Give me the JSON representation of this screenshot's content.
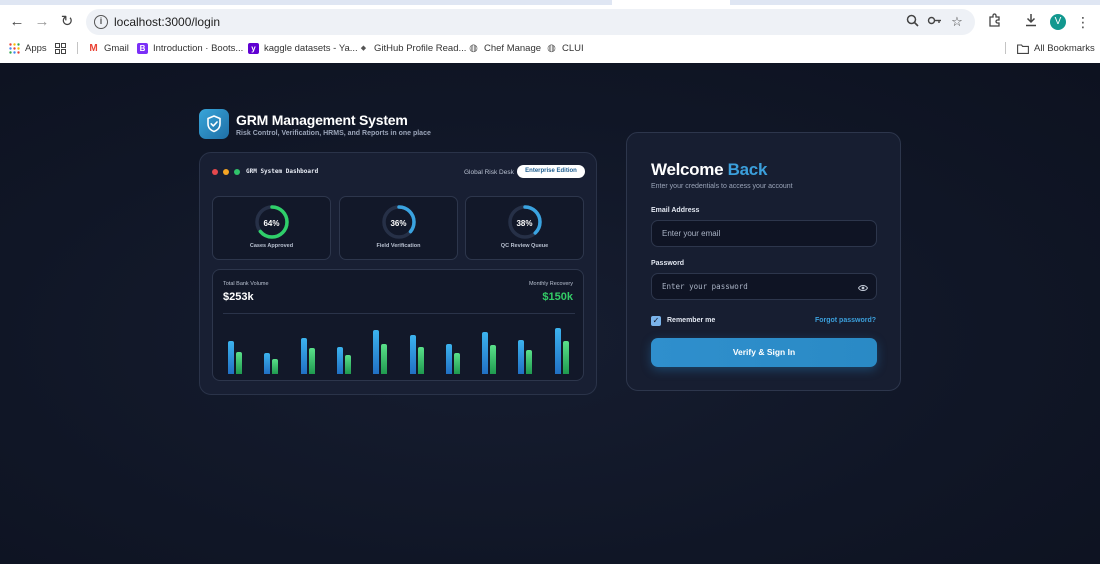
{
  "browser": {
    "url": "localhost:3000/login",
    "avatar_letter": "V",
    "bookmarks": [
      {
        "label": "Apps",
        "icon": "apps-grid-icon"
      },
      {
        "label": "",
        "icon": "tab-groups-icon"
      },
      {
        "label": "Gmail",
        "icon": "gmail-icon"
      },
      {
        "label": "Introduction · Boots...",
        "icon": "bootstrap-icon"
      },
      {
        "label": "kaggle datasets - Ya...",
        "icon": "yahoo-icon"
      },
      {
        "label": "GitHub Profile Read...",
        "icon": "github-icon"
      },
      {
        "label": "Chef Manage",
        "icon": "globe-icon"
      },
      {
        "label": "CLUI",
        "icon": "globe-icon"
      }
    ],
    "all_bookmarks": "All Bookmarks"
  },
  "brand": {
    "title": "GRM Management System",
    "subtitle": "Risk Control, Verification, HRMS, and Reports in one place",
    "logo_icon": "shield-check-icon"
  },
  "dashboard": {
    "title": "GRM System Dashboard",
    "desk": "Global Risk Desk",
    "edition": "Enterprise Edition",
    "window_dots": [
      "#e5484d",
      "#f5a524",
      "#30c36b"
    ],
    "kpis": [
      {
        "percent": "64%",
        "value": 64,
        "label": "Cases Approved",
        "color": "#2fcf6a"
      },
      {
        "percent": "36%",
        "value": 36,
        "label": "Field Verification",
        "color": "#3aa3e0"
      },
      {
        "percent": "38%",
        "value": 38,
        "label": "QC Review Queue",
        "color": "#3aa3e0"
      }
    ],
    "volume_label": "Total Bank Volume",
    "volume_value": "$253k",
    "recovery_label": "Monthly Recovery",
    "recovery_value": "$150k",
    "bars": [
      {
        "blue": 0.66,
        "green": 0.45
      },
      {
        "blue": 0.42,
        "green": 0.3
      },
      {
        "blue": 0.72,
        "green": 0.52
      },
      {
        "blue": 0.55,
        "green": 0.39
      },
      {
        "blue": 0.89,
        "green": 0.61
      },
      {
        "blue": 0.79,
        "green": 0.55
      },
      {
        "blue": 0.61,
        "green": 0.42
      },
      {
        "blue": 0.84,
        "green": 0.58
      },
      {
        "blue": 0.69,
        "green": 0.48
      },
      {
        "blue": 0.93,
        "green": 0.66
      }
    ]
  },
  "login": {
    "welcome": "Welcome",
    "welcome_accent": "Back",
    "subtitle": "Enter your credentials to access your account",
    "email_label": "Email Address",
    "email_placeholder": "Enter your email",
    "password_label": "Password",
    "password_placeholder": "Enter your password",
    "remember": "Remember me",
    "remember_checked": true,
    "forgot": "Forgot password?",
    "submit": "Verify & Sign In"
  }
}
